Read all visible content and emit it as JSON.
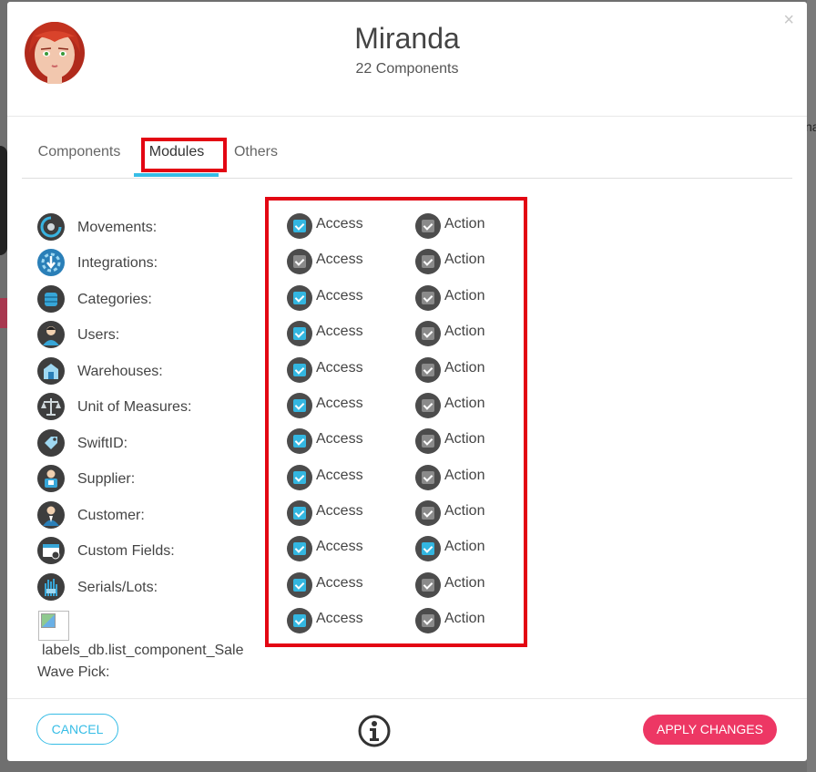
{
  "header": {
    "name": "Miranda",
    "subtitle": "22 Components",
    "close_glyph": "×"
  },
  "tabs": [
    {
      "label": "Components",
      "active": false
    },
    {
      "label": "Modules",
      "active": true
    },
    {
      "label": "Others",
      "active": false
    }
  ],
  "modules": [
    {
      "label": "Movements:",
      "icon": "movements-icon",
      "access": true,
      "action": false
    },
    {
      "label": "Integrations:",
      "icon": "integrations-icon",
      "access": false,
      "action": false
    },
    {
      "label": "Categories:",
      "icon": "categories-icon",
      "access": true,
      "action": false
    },
    {
      "label": "Users:",
      "icon": "users-icon",
      "access": true,
      "action": false
    },
    {
      "label": "Warehouses:",
      "icon": "warehouses-icon",
      "access": true,
      "action": false
    },
    {
      "label": "Unit of Measures:",
      "icon": "scale-icon",
      "access": true,
      "action": false
    },
    {
      "label": "SwiftID:",
      "icon": "tag-icon",
      "access": true,
      "action": false
    },
    {
      "label": "Supplier:",
      "icon": "supplier-icon",
      "access": true,
      "action": false
    },
    {
      "label": "Customer:",
      "icon": "customer-icon",
      "access": true,
      "action": false
    },
    {
      "label": "Custom Fields:",
      "icon": "custom-fields-icon",
      "access": true,
      "action": true
    },
    {
      "label": "Serials/Lots:",
      "icon": "serials-lots-icon",
      "access": true,
      "action": false
    },
    {
      "label": "labels_db.list_component_Sale",
      "icon": "broken-image-icon",
      "access": true,
      "action": false,
      "sublabel": "Wave Pick:"
    }
  ],
  "permissions": {
    "access_label": "Access",
    "action_label": "Action"
  },
  "footer": {
    "cancel_label": "CANCEL",
    "apply_label": "APPLY CHANGES"
  },
  "colors": {
    "accent": "#37bde6",
    "primary": "#ed3764",
    "highlight": "#e30613",
    "checkbox_on": "#33b6e0"
  },
  "background": {
    "right_fragment": "na"
  }
}
